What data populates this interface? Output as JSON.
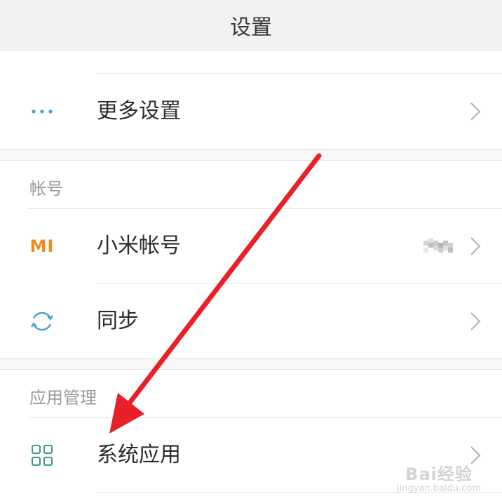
{
  "header": {
    "title": "设置"
  },
  "sections": {
    "top": {
      "items": [
        {
          "label": "更多设置",
          "icon": "more-dots-icon"
        }
      ]
    },
    "account": {
      "header": "帐号",
      "items": [
        {
          "label": "小米帐号",
          "icon": "mi-logo-icon",
          "icon_text": "MI",
          "value": ""
        },
        {
          "label": "同步",
          "icon": "sync-icon"
        }
      ]
    },
    "apps": {
      "header": "应用管理",
      "items": [
        {
          "label": "系统应用",
          "icon": "grid-apps-icon"
        }
      ]
    }
  },
  "watermark": {
    "brand": "Bai经验",
    "url": "jingyan.baidu.com"
  },
  "colors": {
    "accent_blue": "#4a9fd0",
    "mi_orange": "#f08c1a",
    "apps_green": "#3a9a86",
    "annotation_red": "#e8202a"
  }
}
